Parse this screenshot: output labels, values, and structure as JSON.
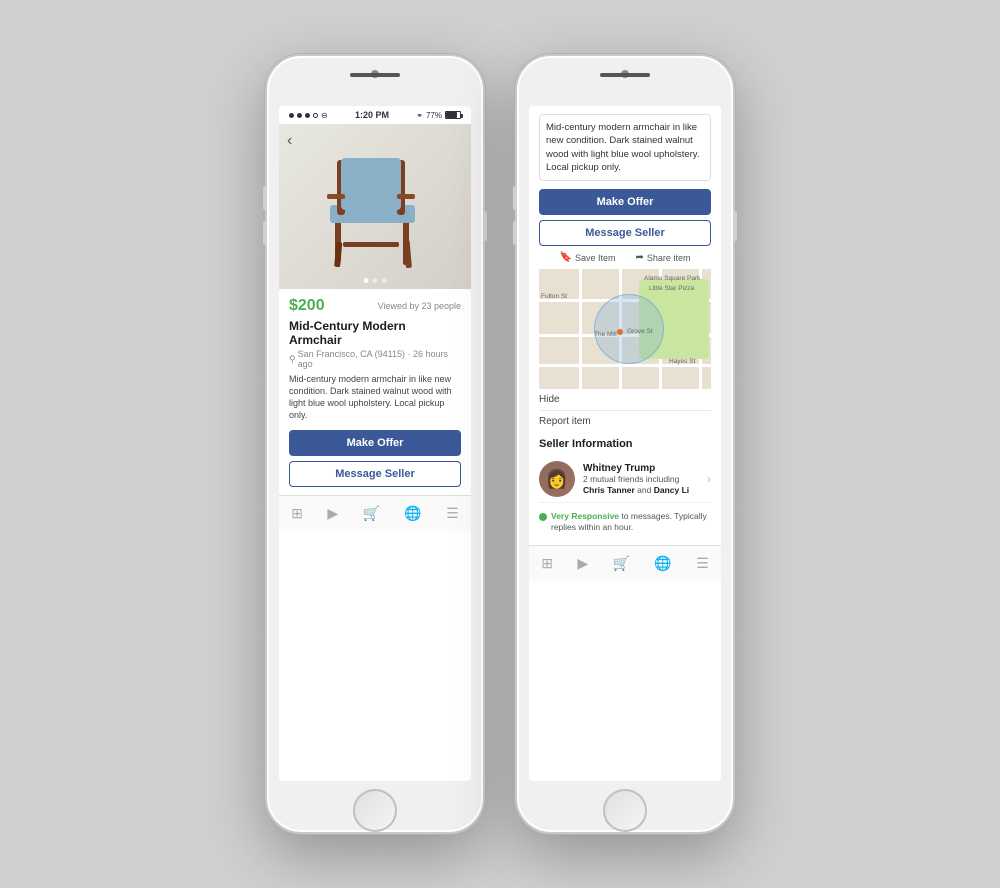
{
  "phone1": {
    "status": {
      "time": "1:20 PM",
      "battery": "77%",
      "bluetooth": "BT"
    },
    "product": {
      "price": "$200",
      "viewed": "Viewed by 23 people",
      "title": "Mid-Century Modern Armchair",
      "location": "San Francisco, CA (94115) · 26 hours ago",
      "description": "Mid-century modern armchair in like new condition. Dark stained walnut wood with light blue wool upholstery. Local pickup only.",
      "make_offer_label": "Make Offer",
      "message_seller_label": "Message Seller"
    },
    "nav": {
      "icons": [
        "⊞",
        "▶",
        "🛍",
        "🌐",
        "☰"
      ]
    }
  },
  "phone2": {
    "description": "Mid-century modern armchair in like new condition. Dark stained walnut wood with light blue wool upholstery. Local pickup only.",
    "make_offer_label": "Make Offer",
    "message_seller_label": "Message Seller",
    "save_label": "Save Item",
    "share_label": "Share item",
    "hide_label": "Hide",
    "report_label": "Report item",
    "seller_info_title": "Seller Information",
    "seller": {
      "name": "Whitney Trump",
      "friends": "2 mutual friends including Chris Tanner and Dancy Li",
      "friends_bold1": "Chris Tanner",
      "friends_bold2": "Dancy Li"
    },
    "responsive": {
      "label": "Very Responsive",
      "text": "to messages. Typically replies within an hour."
    },
    "map": {
      "streets": [
        "Fulton St",
        "Grove St",
        "Hayes St"
      ],
      "places": [
        "The Mill",
        "Little Star Pizza",
        "Alamo Square Park"
      ]
    },
    "nav": {
      "icons": [
        "⊞",
        "▶",
        "🛍",
        "🌐",
        "☰"
      ]
    }
  }
}
